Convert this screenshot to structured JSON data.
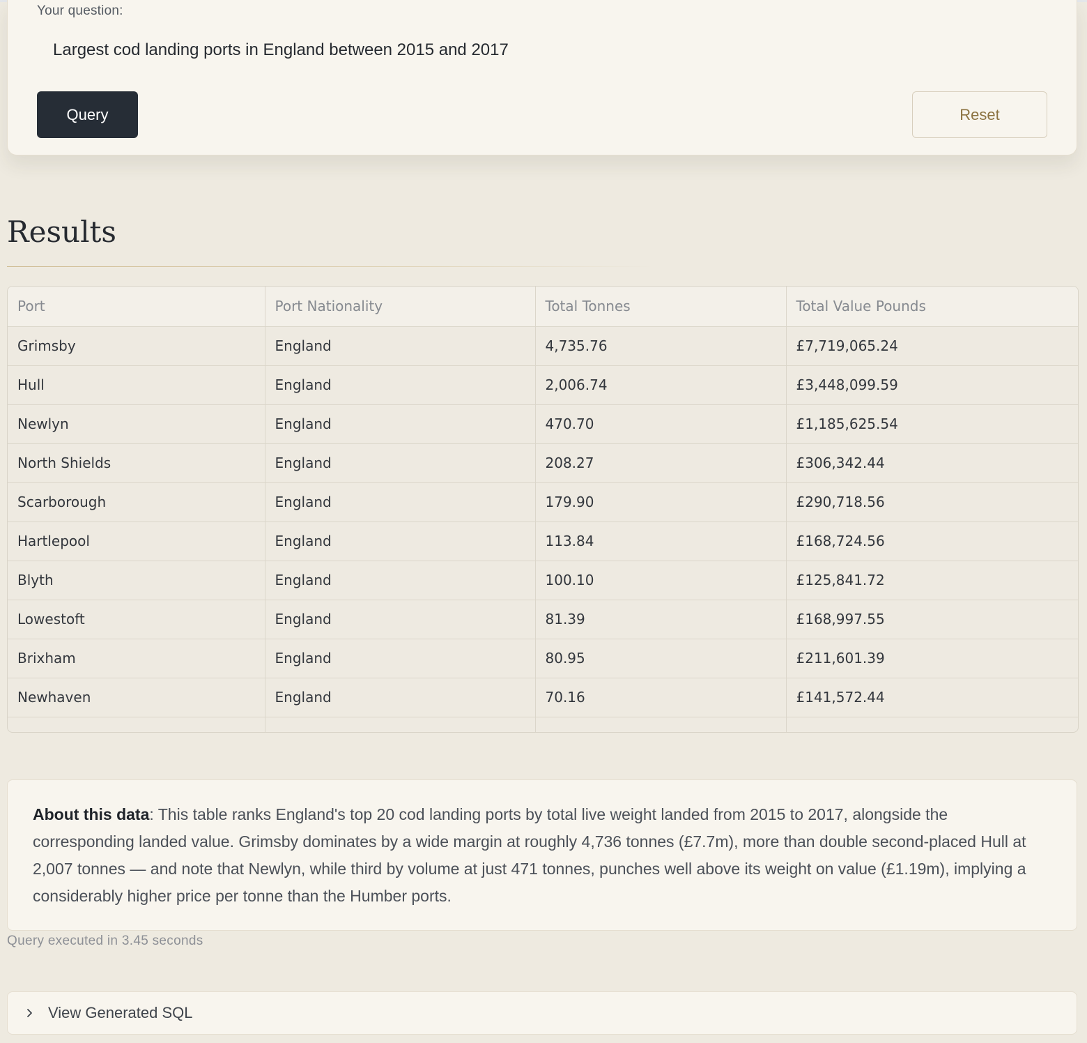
{
  "query_form": {
    "label": "Your question:",
    "question": "Largest cod landing ports in England between 2015 and 2017",
    "query_button": "Query",
    "reset_button": "Reset"
  },
  "results": {
    "title": "Results",
    "columns": [
      "Port",
      "Port Nationality",
      "Total Tonnes",
      "Total Value Pounds"
    ],
    "rows": [
      [
        "Grimsby",
        "England",
        "4,735.76",
        "£7,719,065.24"
      ],
      [
        "Hull",
        "England",
        "2,006.74",
        "£3,448,099.59"
      ],
      [
        "Newlyn",
        "England",
        "470.70",
        "£1,185,625.54"
      ],
      [
        "North Shields",
        "England",
        "208.27",
        "£306,342.44"
      ],
      [
        "Scarborough",
        "England",
        "179.90",
        "£290,718.56"
      ],
      [
        "Hartlepool",
        "England",
        "113.84",
        "£168,724.56"
      ],
      [
        "Blyth",
        "England",
        "100.10",
        "£125,841.72"
      ],
      [
        "Lowestoft",
        "England",
        "81.39",
        "£168,997.55"
      ],
      [
        "Brixham",
        "England",
        "80.95",
        "£211,601.39"
      ],
      [
        "Newhaven",
        "England",
        "70.16",
        "£141,572.44"
      ]
    ]
  },
  "about": {
    "heading": "About this data",
    "text": ": This table ranks England's top 20 cod landing ports by total live weight landed from 2015 to 2017, alongside the corresponding landed value. Grimsby dominates by a wide margin at roughly 4,736 tonnes (£7.7m), more than double second-placed Hull at 2,007 tonnes — and note that Newlyn, while third by volume at just 471 tonnes, punches well above its weight on value (£1.19m), implying a considerably higher price per tonne than the Humber ports."
  },
  "status": {
    "exec_time": "Query executed in 3.45 seconds"
  },
  "sql_toggle": {
    "label": "View Generated SQL",
    "icon": "chevron-right-icon"
  }
}
